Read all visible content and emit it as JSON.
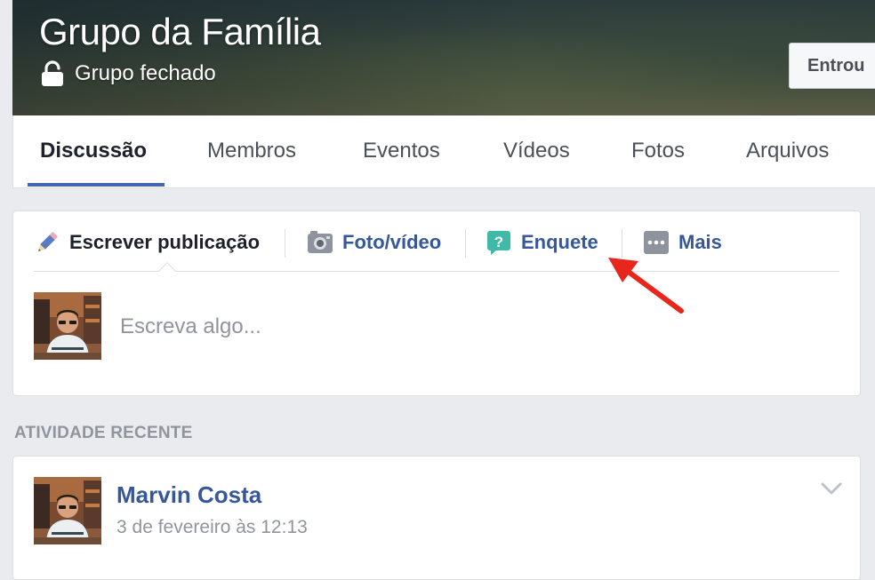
{
  "group": {
    "title": "Grupo da Família",
    "privacy": "Grupo fechado",
    "joined_label": "Entrou"
  },
  "tabs": [
    {
      "label": "Discussão",
      "active": true
    },
    {
      "label": "Membros"
    },
    {
      "label": "Eventos"
    },
    {
      "label": "Vídeos"
    },
    {
      "label": "Fotos"
    },
    {
      "label": "Arquivos"
    }
  ],
  "composer": {
    "actions": [
      {
        "label": "Escrever publicação",
        "icon": "pencil-icon"
      },
      {
        "label": "Foto/vídeo",
        "icon": "camera-icon"
      },
      {
        "label": "Enquete",
        "icon": "poll-question-icon"
      },
      {
        "label": "Mais",
        "icon": "more-dots-icon"
      }
    ],
    "placeholder": "Escreva algo..."
  },
  "recent": {
    "heading": "ATIVIDADE RECENTE",
    "post": {
      "author": "Marvin Costa",
      "time": "3 de fevereiro às 12:13"
    }
  },
  "colors": {
    "link_blue": "#365899",
    "accent_blue": "#4267b2",
    "background": "#e9ebee",
    "annotation_red": "#e8261c",
    "poll_green": "#40b9a6"
  }
}
